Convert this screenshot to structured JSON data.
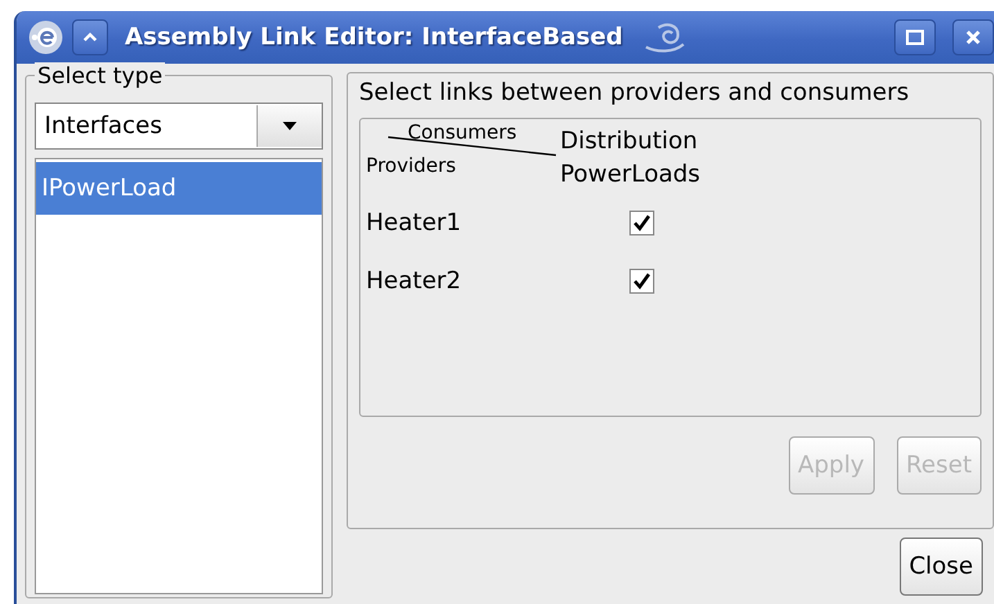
{
  "window": {
    "title": "Assembly Link Editor: InterfaceBased"
  },
  "select_type": {
    "legend": "Select type",
    "combo_value": "Interfaces",
    "items": [
      {
        "label": "IPowerLoad",
        "selected": true
      }
    ]
  },
  "links": {
    "heading": "Select links between providers and consumers",
    "corner_consumers": "Consumers",
    "corner_providers": "Providers",
    "columns": [
      "Distribution\nPowerLoads"
    ],
    "rows": [
      {
        "provider": "Heater1",
        "checked": true
      },
      {
        "provider": "Heater2",
        "checked": true
      }
    ],
    "buttons": [
      {
        "label": "Apply",
        "disabled": true
      },
      {
        "label": "Reset",
        "disabled": true
      }
    ]
  },
  "close_button": {
    "label": "Close"
  }
}
